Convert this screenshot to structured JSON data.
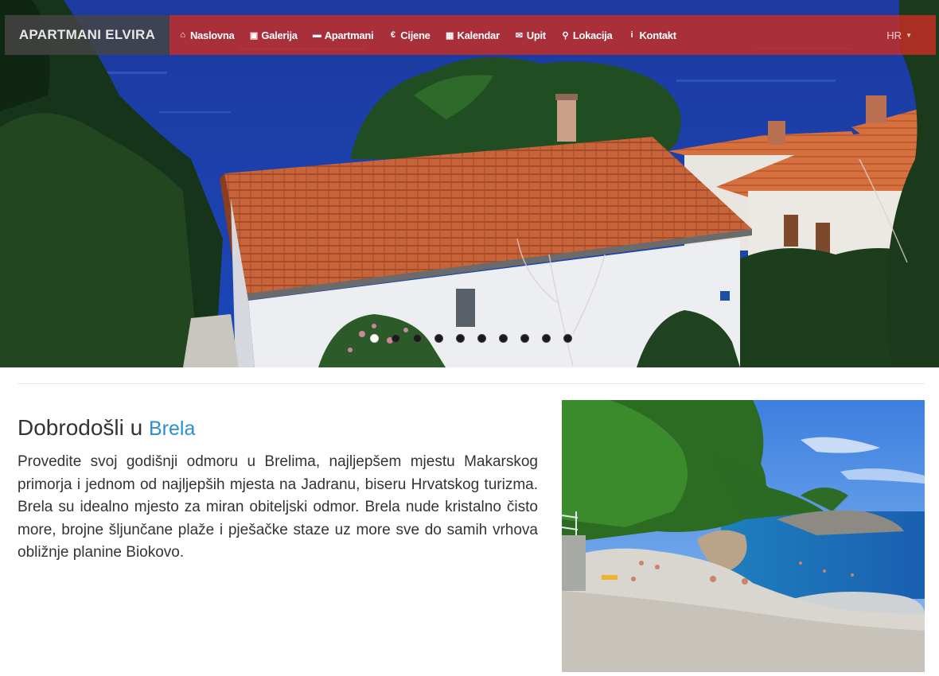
{
  "brand": "APARTMANI ELVIRA",
  "nav": {
    "items": [
      {
        "icon": "home-icon",
        "glyph": "⌂",
        "label": "Naslovna"
      },
      {
        "icon": "image-icon",
        "glyph": "▣",
        "label": "Galerija"
      },
      {
        "icon": "bed-icon",
        "glyph": "▬",
        "label": "Apartmani"
      },
      {
        "icon": "euro-icon",
        "glyph": "€",
        "label": "Cijene"
      },
      {
        "icon": "calendar-icon",
        "glyph": "▦",
        "label": "Kalendar"
      },
      {
        "icon": "envelope-icon",
        "glyph": "✉",
        "label": "Upit"
      },
      {
        "icon": "map-marker-icon",
        "glyph": "⚲",
        "label": "Lokacija"
      },
      {
        "icon": "info-icon",
        "glyph": "i",
        "label": "Kontakt"
      }
    ],
    "language": "HR"
  },
  "carousel": {
    "slide_count": 10,
    "active_index": 0
  },
  "welcome": {
    "heading": "Dobrodošli u",
    "town": "Brela"
  },
  "intro_text": "Provedite svoj godišnji odmoru u Brelima, najljepšem mjestu Makarskog primorja i jednom od najljepših mjesta na Jadranu, biseru Hrvatskog turizma. Brela su idealno mjesto za miran obiteljski odmor. Brela nude kristalno čisto more, brojne šljunčane plaže i pješačke staze uz more sve do samih vrhova obližnje planine Biokovo.",
  "colors": {
    "nav_red": "#c82d23",
    "brand_gray": "#444444",
    "link_blue": "#2a8fd0"
  }
}
